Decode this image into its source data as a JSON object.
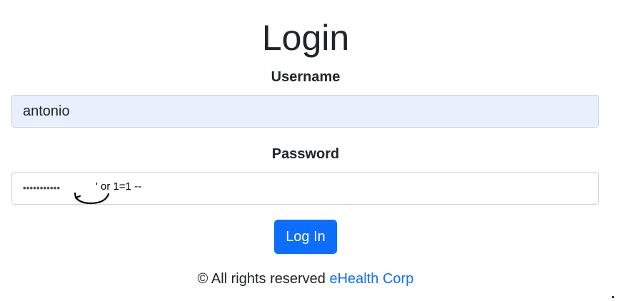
{
  "page": {
    "title": "Login"
  },
  "form": {
    "username_label": "Username",
    "username_value": "antonio",
    "password_label": "Password",
    "password_masked": "•••••••••••",
    "injection_annotation": "' or 1=1 --",
    "submit_label": "Log In"
  },
  "footer": {
    "text": "© All rights reserved ",
    "link_text": "eHealth Corp"
  },
  "colors": {
    "accent": "#0d6efd",
    "autofill_background": "#e8f0fe"
  },
  "icons": {
    "annotation": "curved-arrow-icon"
  }
}
